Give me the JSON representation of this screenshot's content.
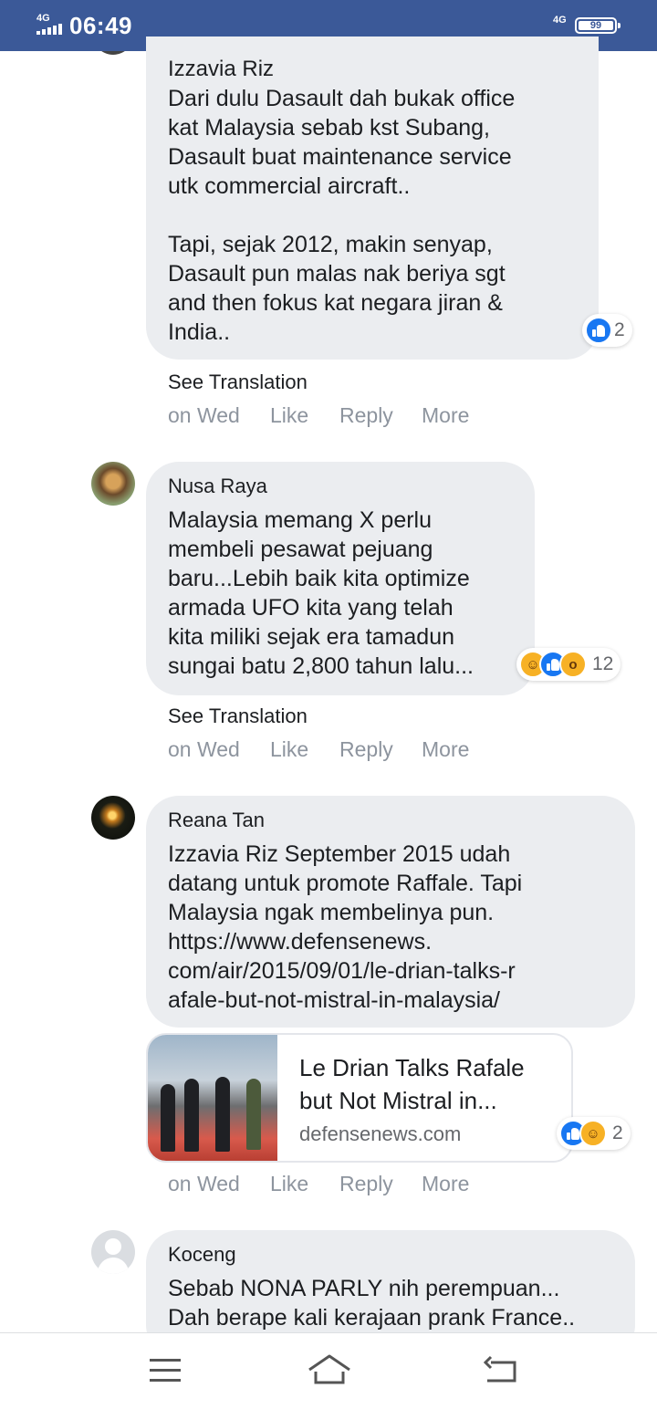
{
  "status_bar": {
    "network_left": "4G",
    "time": "06:49",
    "network_right": "4G",
    "battery": "99"
  },
  "comments": [
    {
      "name": "Izzavia Riz",
      "text": "Dari dulu Dasault dah bukak office\nkat Malaysia sebab kst Subang,\nDasault buat maintenance service\nutk commercial aircraft..\n\nTapi, sejak 2012, makin senyap,\nDasault pun malas nak beriya sgt\nand then fokus kat negara jiran &\nIndia..",
      "reaction_count": "2",
      "reactions": [
        "like-icon"
      ],
      "see_translation": "See Translation",
      "time": "on Wed",
      "like": "Like",
      "reply": "Reply",
      "more": "More"
    },
    {
      "name": "Nusa Raya",
      "text": "Malaysia memang X perlu\nmembeli pesawat pejuang\nbaru...Lebih baik kita optimize\narmada UFO kita yang telah\nkita miliki sejak era tamadun\nsungai batu 2,800 tahun lalu...",
      "reaction_count": "12",
      "reactions": [
        "haha-icon",
        "like-icon",
        "wow-icon"
      ],
      "see_translation": "See Translation",
      "time": "on Wed",
      "like": "Like",
      "reply": "Reply",
      "more": "More"
    },
    {
      "name": "Reana Tan",
      "text": "Izzavia Riz September 2015 udah\ndatang untuk promote Raffale. Tapi\nMalaysia ngak membelinya pun.\nhttps://www.defensenews.\ncom/air/2015/09/01/le-drian-talks-r\nafale-but-not-mistral-in-malaysia/",
      "link_card": {
        "title": "Le Drian Talks Rafale\nbut Not Mistral in...",
        "domain": "defensenews.com"
      },
      "reaction_count": "2",
      "reactions": [
        "like-icon",
        "haha-icon"
      ],
      "time": "on Wed",
      "like": "Like",
      "reply": "Reply",
      "more": "More"
    },
    {
      "name": "Koceng",
      "text": "Sebab NONA PARLY nih perempuan...\nDah berape kali kerajaan prank France.."
    }
  ],
  "colors": {
    "status_bar": "#3b5998",
    "bubble": "#ebedf0",
    "like": "#1877f2",
    "haha": "#f7b125",
    "meta_text": "#8d949e"
  }
}
